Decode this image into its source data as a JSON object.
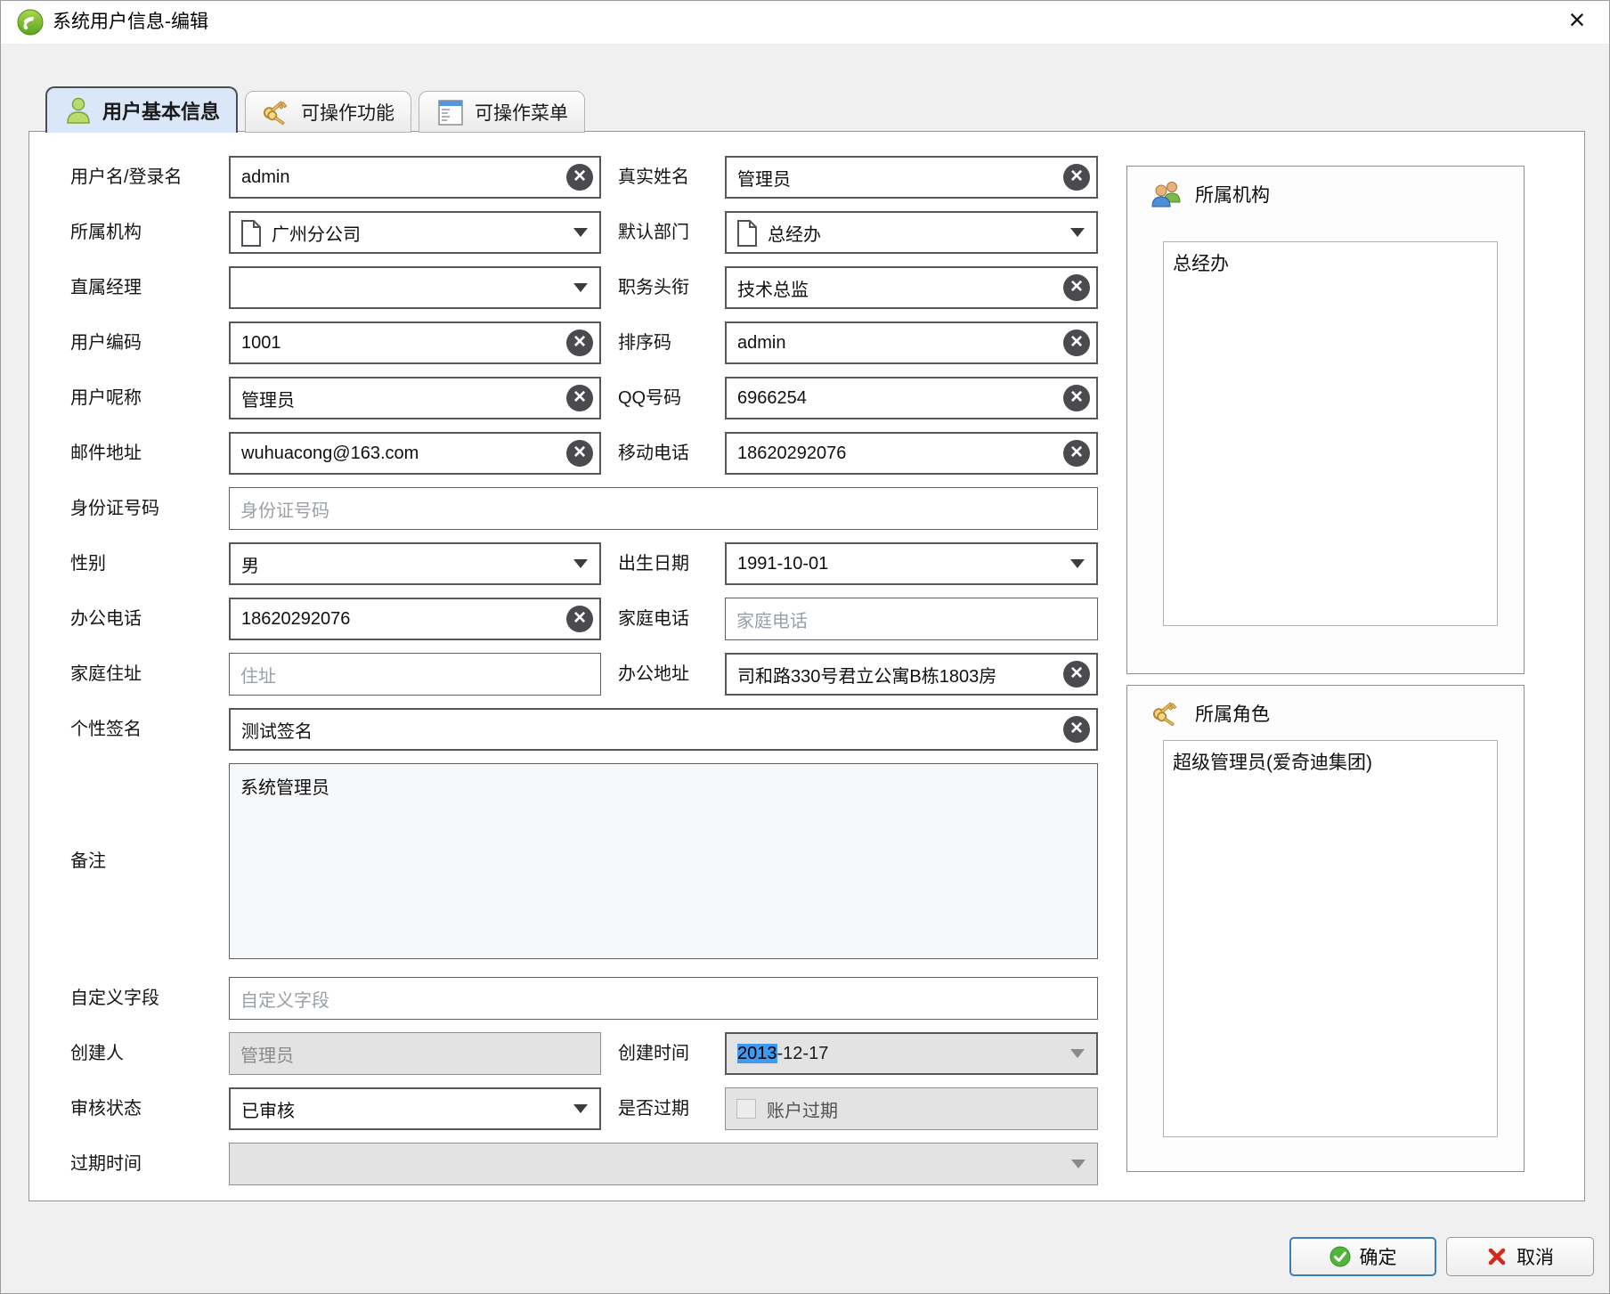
{
  "window": {
    "title": "系统用户信息-编辑",
    "close_glyph": "×"
  },
  "tabs": [
    {
      "label": "用户基本信息",
      "active": true
    },
    {
      "label": "可操作功能",
      "active": false
    },
    {
      "label": "可操作菜单",
      "active": false
    }
  ],
  "form": {
    "username": {
      "label": "用户名/登录名",
      "value": "admin"
    },
    "realname": {
      "label": "真实姓名",
      "value": "管理员"
    },
    "org": {
      "label": "所属机构",
      "value": "广州分公司"
    },
    "dept": {
      "label": "默认部门",
      "value": "总经办"
    },
    "manager": {
      "label": "直属经理",
      "value": ""
    },
    "jobtitle": {
      "label": "职务头衔",
      "value": "技术总监"
    },
    "usercode": {
      "label": "用户编码",
      "value": "1001"
    },
    "sortcode": {
      "label": "排序码",
      "value": "admin"
    },
    "nickname": {
      "label": "用户呢称",
      "value": "管理员"
    },
    "qq": {
      "label": "QQ号码",
      "value": "6966254"
    },
    "email": {
      "label": "邮件地址",
      "value": "wuhuacong@163.com"
    },
    "mobile": {
      "label": "移动电话",
      "value": "18620292076"
    },
    "idcard": {
      "label": "身份证号码",
      "placeholder": "身份证号码"
    },
    "gender": {
      "label": "性别",
      "value": "男"
    },
    "birthday": {
      "label": "出生日期",
      "value": "1991-10-01"
    },
    "officephone": {
      "label": "办公电话",
      "value": "18620292076"
    },
    "homephone": {
      "label": "家庭电话",
      "placeholder": "家庭电话"
    },
    "homeaddr": {
      "label": "家庭住址",
      "placeholder": "住址"
    },
    "officeaddr": {
      "label": "办公地址",
      "value": "司和路330号君立公寓B栋1803房"
    },
    "signature": {
      "label": "个性签名",
      "value": "测试签名"
    },
    "note": {
      "label": "备注",
      "value": "系统管理员"
    },
    "customfield": {
      "label": "自定义字段",
      "placeholder": "自定义字段"
    },
    "creator": {
      "label": "创建人",
      "value": "管理员"
    },
    "createtime": {
      "label": "创建时间",
      "selected": "2013",
      "rest": "-12-17"
    },
    "audit": {
      "label": "审核状态",
      "value": "已审核"
    },
    "expired": {
      "label": "是否过期",
      "checkbox_label": "账户过期",
      "checked": false
    },
    "expiretime": {
      "label": "过期时间",
      "value": ""
    }
  },
  "panels": {
    "org_panel": {
      "title": "所属机构",
      "items": [
        "总经办"
      ]
    },
    "role_panel": {
      "title": "所属角色",
      "items": [
        "超级管理员(爱奇迪集团)"
      ]
    }
  },
  "footer": {
    "ok_label": "确定",
    "cancel_label": "取消"
  },
  "colors": {
    "selection": "#3d9bf0",
    "active_tab_bg": "#d9e7f8",
    "ok_border": "#3a7ebf"
  }
}
